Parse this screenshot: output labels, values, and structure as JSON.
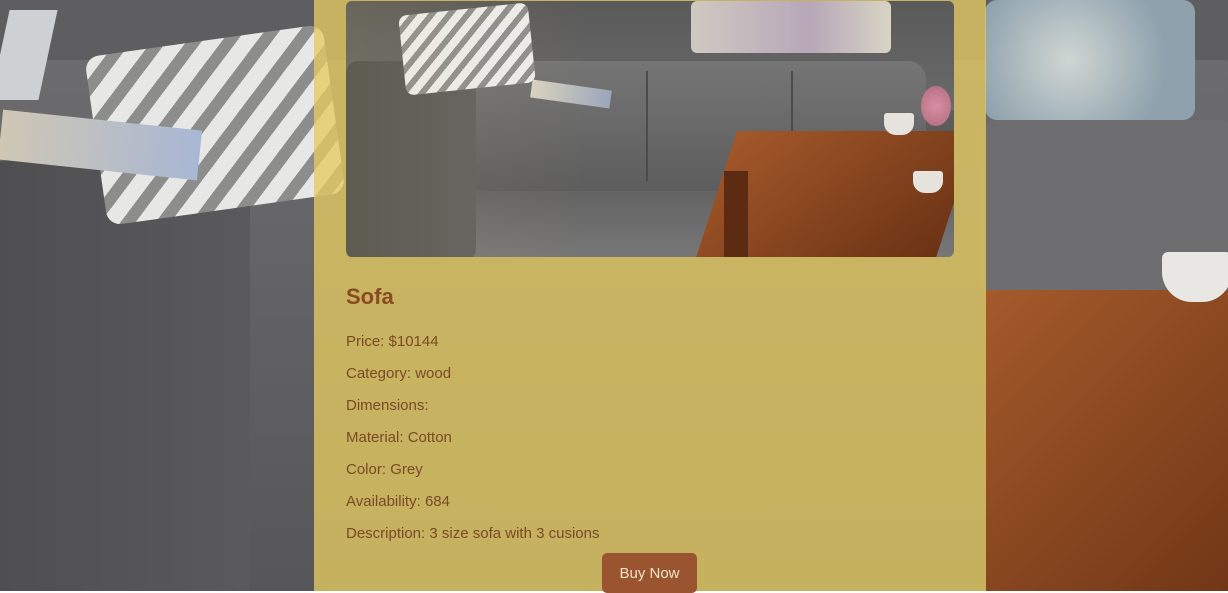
{
  "product": {
    "name": "Sofa",
    "details": [
      {
        "label": "Price:",
        "value": "$10144"
      },
      {
        "label": "Category:",
        "value": "wood"
      },
      {
        "label": "Dimensions:",
        "value": ""
      },
      {
        "label": "Material:",
        "value": "Cotton"
      },
      {
        "label": "Color:",
        "value": "Grey"
      },
      {
        "label": "Availability:",
        "value": "684"
      },
      {
        "label": "Description:",
        "value": "3 size sofa with 3 cusions"
      }
    ],
    "image_alt": "grey sofa with wooden coffee table"
  },
  "actions": {
    "buy_label": "Buy Now"
  },
  "colors": {
    "card_bg": "#e6cb62",
    "title": "#8a4a22",
    "text": "#7a4a26",
    "button_bg": "#9a5530",
    "button_text": "#f5e3c8"
  }
}
